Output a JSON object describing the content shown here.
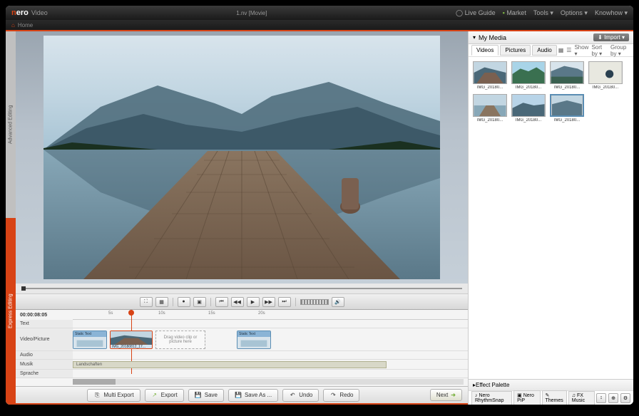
{
  "titlebar": {
    "logo_text": "nero",
    "app_name": "Video",
    "document": "1.nv [Movie]",
    "live_guide": "Live Guide",
    "market": "Market",
    "tools": "Tools",
    "options": "Options",
    "knowhow": "Knowhow"
  },
  "menubar": {
    "home": "Home"
  },
  "rail": {
    "advanced": "Advanced Editing",
    "express": "Express Editing"
  },
  "transport": {
    "icons": [
      "full",
      "grid",
      "sep",
      "record",
      "camera",
      "sep",
      "prev",
      "rewind",
      "play",
      "fwd",
      "next",
      "sep"
    ]
  },
  "media_panel": {
    "title": "My Media",
    "import": "Import",
    "tabs": {
      "videos": "Videos",
      "pictures": "Pictures",
      "audio": "Audio"
    },
    "toolbar": {
      "show": "Show",
      "sort": "Sort by",
      "group": "Group by"
    },
    "items": [
      {
        "label": "IMG_20180..."
      },
      {
        "label": "IMG_20180..."
      },
      {
        "label": "IMG_20180..."
      },
      {
        "label": "IMG_20180..."
      },
      {
        "label": "IMG_20180..."
      },
      {
        "label": "IMG_20180..."
      },
      {
        "label": "IMG_20180..."
      }
    ]
  },
  "effects": {
    "title": "Effect Palette",
    "tabs": {
      "rhythm": "Nero RhythmSnap",
      "pip": "Nero PiP",
      "themes": "Themes",
      "fxmusic": "FX Music"
    }
  },
  "timeline": {
    "timecode": "00:00:08:05",
    "ticks": [
      "5s",
      "10s",
      "15s",
      "20s"
    ],
    "rows": {
      "text": "Text",
      "video": "Video/Picture",
      "audio": "Audio",
      "musik": "Musik",
      "sprache": "Sprache"
    },
    "clips": {
      "static1": "Static Text",
      "static2": "Static Text",
      "video_name": "IMG_20180812_17...",
      "drop_hint": "Drag video clip or picture here"
    },
    "musik_clip": "Landschaften"
  },
  "bottom": {
    "multi_export": "Multi Export",
    "export": "Export",
    "save": "Save",
    "save_as": "Save As ...",
    "undo": "Undo",
    "redo": "Redo",
    "next": "Next"
  }
}
